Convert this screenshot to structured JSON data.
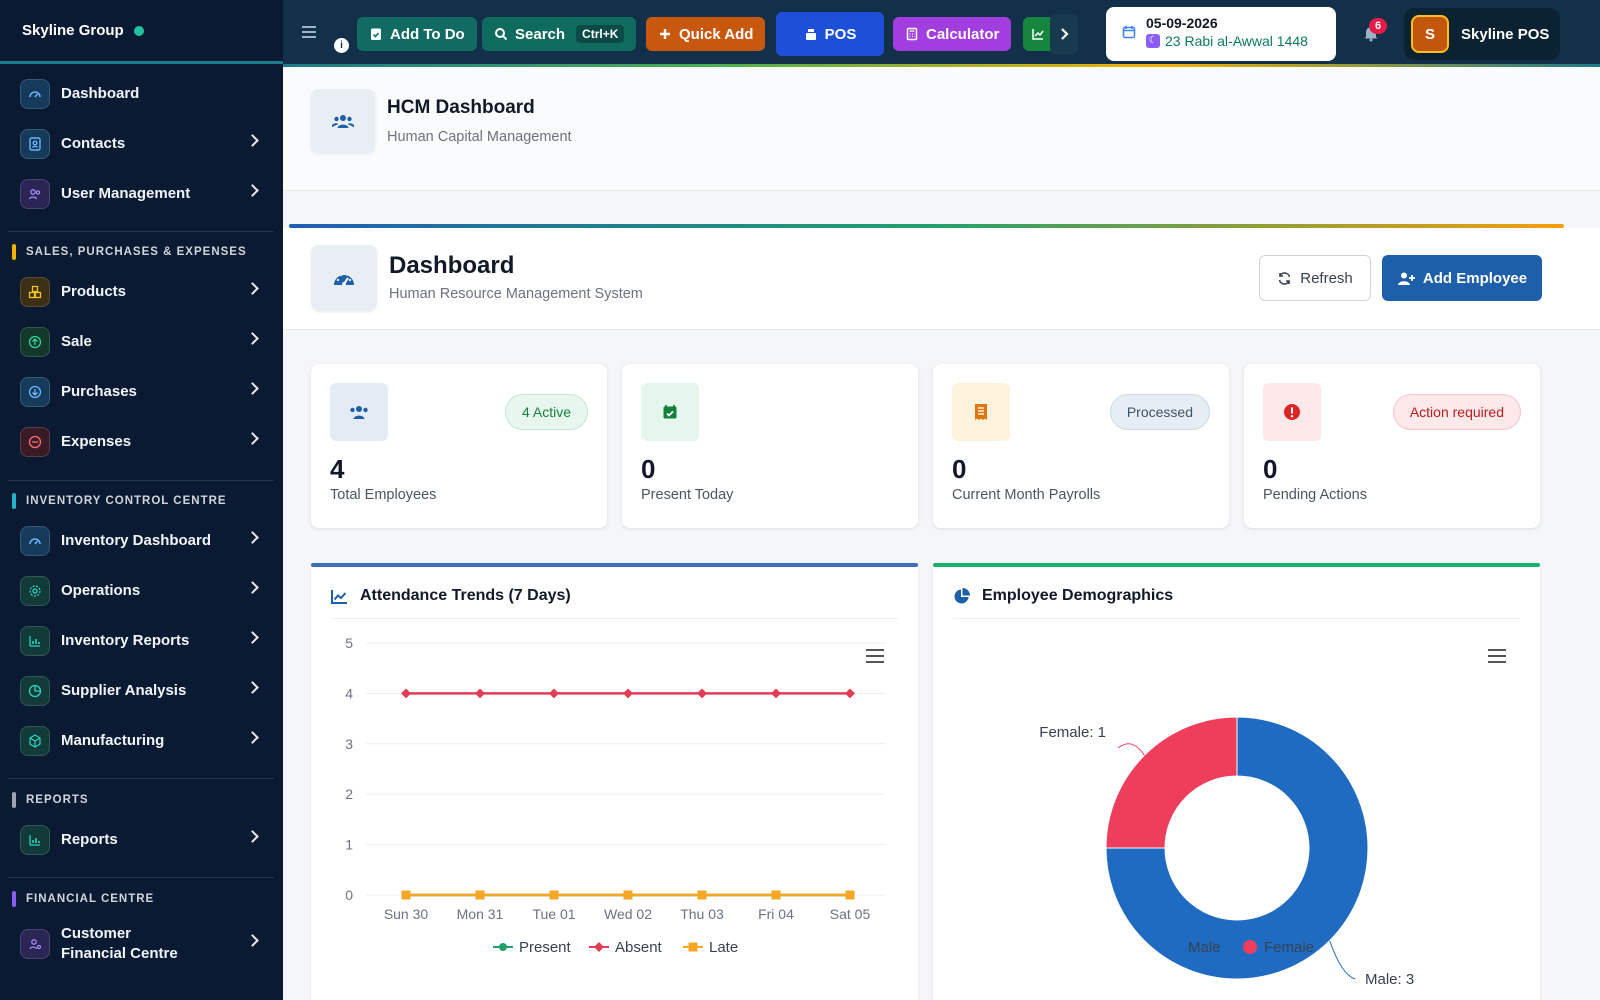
{
  "brand": {
    "name": "Skyline Group"
  },
  "sidebar": {
    "items": [
      {
        "label": "Dashboard"
      },
      {
        "label": "Contacts"
      },
      {
        "label": "User Management"
      },
      {
        "label": "Products"
      },
      {
        "label": "Sale"
      },
      {
        "label": "Purchases"
      },
      {
        "label": "Expenses"
      },
      {
        "label": "Inventory Dashboard"
      },
      {
        "label": "Operations"
      },
      {
        "label": "Inventory Reports"
      },
      {
        "label": "Supplier Analysis"
      },
      {
        "label": "Manufacturing"
      },
      {
        "label": "Reports"
      },
      {
        "label": "Customer Financial Centre"
      }
    ],
    "sections": [
      {
        "title": "SALES, PURCHASES & EXPENSES",
        "color": "#f5b300"
      },
      {
        "title": "INVENTORY CONTROL CENTRE",
        "color": "#22b3c9"
      },
      {
        "title": "REPORTS",
        "color": "#9ca3af"
      },
      {
        "title": "FINANCIAL CENTRE",
        "color": "#8b5cf6"
      }
    ]
  },
  "topbar": {
    "add_todo": "Add To Do",
    "search": "Search",
    "search_shortcut": "Ctrl+K",
    "quick_add": "Quick Add",
    "pos": "POS",
    "calculator": "Calculator",
    "date": "05-09-2026",
    "hijri": "23 Rabi al-Awwal 1448",
    "notifications": "6",
    "user_initial": "S",
    "user_name": "Skyline POS",
    "info": "i"
  },
  "hcm": {
    "title": "HCM Dashboard",
    "subtitle": "Human Capital Management"
  },
  "dashboard": {
    "title": "Dashboard",
    "subtitle": "Human Resource Management System",
    "refresh": "Refresh",
    "add_employee": "Add Employee"
  },
  "stats": [
    {
      "value": "4",
      "caption": "Total Employees",
      "badge": "4 Active"
    },
    {
      "value": "0",
      "caption": "Present Today",
      "badge": ""
    },
    {
      "value": "0",
      "caption": "Current Month Payrolls",
      "badge": "Processed"
    },
    {
      "value": "0",
      "caption": "Pending Actions",
      "badge": "Action required"
    }
  ],
  "attendance": {
    "title": "Attendance Trends (7 Days)"
  },
  "demographics": {
    "title": "Employee Demographics"
  },
  "chart_data": [
    {
      "type": "line",
      "title": "Attendance Trends (7 Days)",
      "categories": [
        "Sun 30",
        "Mon 31",
        "Tue 01",
        "Wed 02",
        "Thu 03",
        "Fri 04",
        "Sat 05"
      ],
      "series": [
        {
          "name": "Present",
          "values": [
            0,
            0,
            0,
            0,
            0,
            0,
            0
          ],
          "color": "#22a06b"
        },
        {
          "name": "Absent",
          "values": [
            4,
            4,
            4,
            4,
            4,
            4,
            4
          ],
          "color": "#e23d57"
        },
        {
          "name": "Late",
          "values": [
            0,
            0,
            0,
            0,
            0,
            0,
            0
          ],
          "color": "#f5a623"
        }
      ],
      "ylim": [
        0,
        5
      ],
      "yticks": [
        "0",
        "1",
        "2",
        "3",
        "4",
        "5"
      ],
      "grid": true,
      "legend": "bottom"
    },
    {
      "type": "pie",
      "title": "Employee Demographics",
      "categories": [
        "Male",
        "Female"
      ],
      "values": [
        3,
        1
      ],
      "data_labels": [
        "Male: 3",
        "Female: 1"
      ],
      "colors": [
        "#1f6bc2",
        "#ef3e5c"
      ],
      "legend": "bottom"
    }
  ]
}
